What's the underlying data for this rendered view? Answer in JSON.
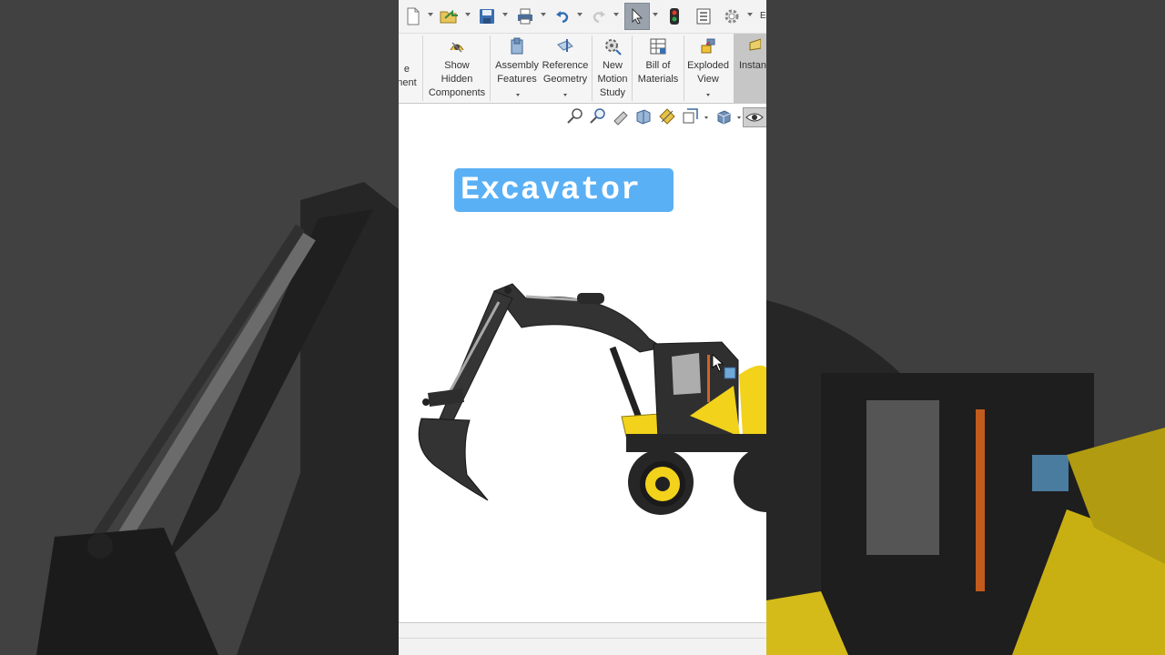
{
  "video_title": "Excavator",
  "ribbon": {
    "items": [
      {
        "id": "edit-component",
        "label": "e\nnent"
      },
      {
        "id": "show-hidden",
        "label": "Show\nHidden\nComponents"
      },
      {
        "id": "assembly-features",
        "label": "Assembly\nFeatures"
      },
      {
        "id": "reference-geometry",
        "label": "Reference\nGeometry"
      },
      {
        "id": "new-motion-study",
        "label": "New\nMotion\nStudy"
      },
      {
        "id": "bill-of-materials",
        "label": "Bill of\nMaterials"
      },
      {
        "id": "exploded-view",
        "label": "Exploded\nView"
      },
      {
        "id": "instant3d",
        "label": "Instan"
      }
    ]
  },
  "qat_trailing_text": "E",
  "icons": [
    "new-document-icon",
    "open-icon",
    "save-icon",
    "print-icon",
    "undo-icon",
    "redo-icon",
    "select-pointer-icon",
    "rebuild-traffic-light-icon",
    "file-properties-icon",
    "options-gear-icon"
  ],
  "colors": {
    "badge": "#5ab0f5",
    "excavator_yellow": "#f2d21a",
    "excavator_body": "#333333"
  }
}
